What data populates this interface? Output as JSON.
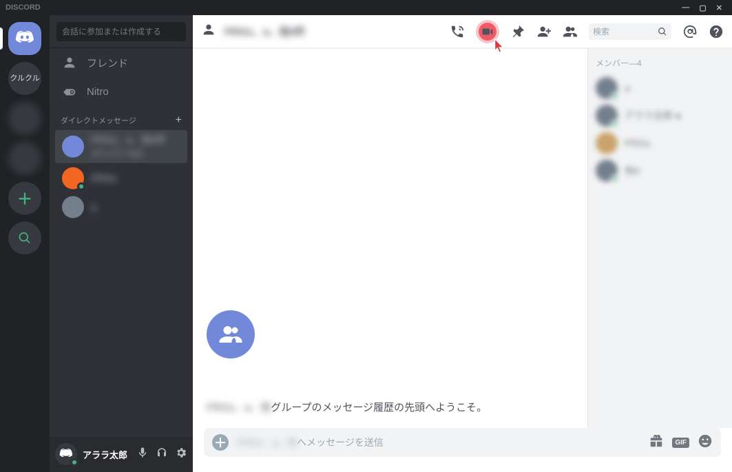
{
  "titlebar": {
    "brand": "DISCORD"
  },
  "serverlist": {
    "server2_label": "クルクル"
  },
  "sidebar": {
    "search_placeholder": "会話に参加または作成する",
    "friends_label": "フレンド",
    "nitro_label": "Nitro",
    "dm_header": "ダイレクトメッセージ",
    "dm_add": "+"
  },
  "userpanel": {
    "username": "アララ太郎"
  },
  "header": {
    "group_name_blur": "PRGs、a、他4件",
    "search_placeholder": "検索"
  },
  "welcome": {
    "blur_prefix": "PRGs、a、他",
    "text": "グループのメッセージ履歴の先頭へようこそ。"
  },
  "composer": {
    "blur_prefix": "PRGs、a、他",
    "placeholder_suffix": "へメッセージを送信",
    "gif_label": "GIF"
  },
  "members": {
    "header_prefix": "メンバー—",
    "count": "4"
  }
}
